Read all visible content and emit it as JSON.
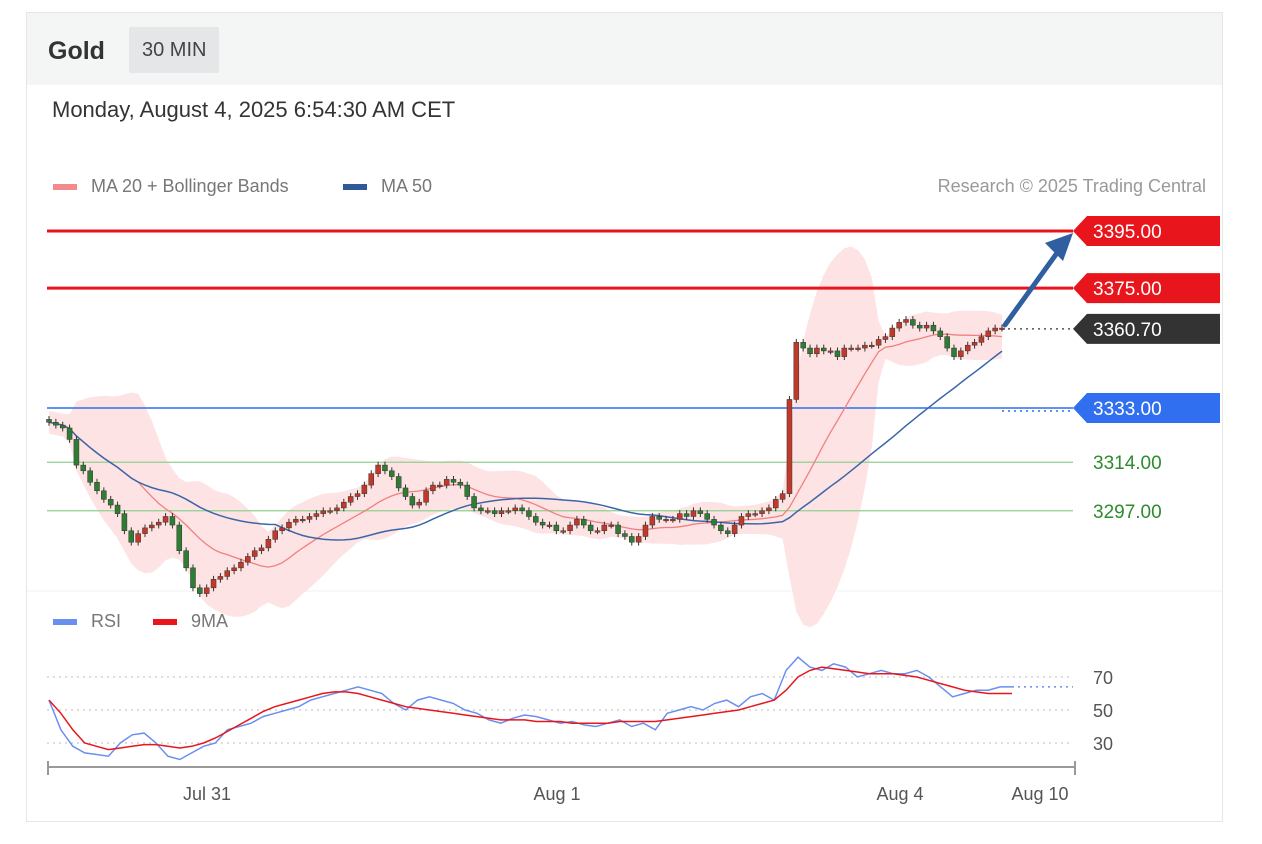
{
  "header": {
    "asset": "Gold",
    "timeframe": "30 MIN"
  },
  "datetime": "Monday, August 4, 2025 6:54:30 AM CET",
  "legend": {
    "ma20_label": "MA 20 + Bollinger Bands",
    "ma50_label": "MA 50"
  },
  "credit": "Research © 2025 Trading Central",
  "rsi_legend": {
    "rsi_label": "RSI",
    "ma_label": "9MA"
  },
  "colors": {
    "red": "#e8161c",
    "blue": "#2f6ff0",
    "green": "#2e8b2e",
    "ma50": "#3a66a8",
    "band": "#fde0e0",
    "current": "#333333"
  },
  "chart_data": [
    {
      "type": "line",
      "title": "",
      "x_ticks": [
        "Jul 31",
        "Aug 1",
        "Aug 4",
        "Aug 10"
      ],
      "ylim": [
        3265,
        3400
      ],
      "levels": [
        {
          "label": "3395.00",
          "value": 3395.0,
          "kind": "resistance",
          "color": "#e8161c"
        },
        {
          "label": "3375.00",
          "value": 3375.0,
          "kind": "resistance",
          "color": "#e8161c"
        },
        {
          "label": "3360.70",
          "value": 3360.7,
          "kind": "current",
          "color": "#333333"
        },
        {
          "label": "3333.00",
          "value": 3333.0,
          "kind": "pivot",
          "color": "#2f6ff0"
        },
        {
          "label": "3314.00",
          "value": 3314.0,
          "kind": "support",
          "color": "#2e8b2e"
        },
        {
          "label": "3297.00",
          "value": 3297.0,
          "kind": "support",
          "color": "#2e8b2e"
        }
      ],
      "candles_close": [
        3328,
        3327,
        3326,
        3322,
        3313,
        3311,
        3307,
        3304,
        3301,
        3299,
        3296,
        3290,
        3286,
        3289,
        3291,
        3292,
        3293,
        3295,
        3292,
        3283,
        3277,
        3270,
        3268,
        3270,
        3273,
        3274,
        3276,
        3277,
        3279,
        3281,
        3283,
        3284,
        3287,
        3290,
        3291,
        3293,
        3294,
        3294,
        3295,
        3296,
        3297,
        3297,
        3298,
        3300,
        3302,
        3303,
        3306,
        3310,
        3313,
        3311,
        3309,
        3305,
        3302,
        3299,
        3300,
        3304,
        3306,
        3306,
        3308,
        3307,
        3306,
        3302,
        3298,
        3297,
        3297,
        3296,
        3297,
        3297,
        3298,
        3297,
        3295,
        3293,
        3292,
        3292,
        3290,
        3290,
        3292,
        3294,
        3292,
        3290,
        3290,
        3292,
        3292,
        3289,
        3288,
        3286,
        3288,
        3292,
        3295,
        3294,
        3294,
        3294,
        3296,
        3295,
        3297,
        3296,
        3294,
        3292,
        3290,
        3289,
        3292,
        3295,
        3296,
        3296,
        3297,
        3298,
        3301,
        3303,
        3336,
        3356,
        3354,
        3352,
        3354,
        3353,
        3353,
        3351,
        3354,
        3354,
        3354,
        3355,
        3355,
        3357,
        3358,
        3361,
        3363,
        3364,
        3362,
        3361,
        3362,
        3360,
        3358,
        3354,
        3351,
        3353,
        3355,
        3356,
        3358,
        3360,
        3361,
        3361
      ],
      "series": [
        {
          "name": "MA 20 + Bollinger Bands",
          "kind": "ma20_band"
        },
        {
          "name": "MA 50",
          "kind": "ma50"
        }
      ]
    },
    {
      "type": "line",
      "title": "",
      "y_ticks": [
        "70",
        "50",
        "30"
      ],
      "ylim": [
        10,
        90
      ],
      "series": [
        {
          "name": "RSI",
          "values": [
            56,
            38,
            28,
            24,
            23,
            22,
            30,
            35,
            36,
            30,
            22,
            20,
            24,
            28,
            30,
            38,
            40,
            42,
            46,
            48,
            50,
            52,
            56,
            58,
            60,
            62,
            64,
            62,
            60,
            54,
            50,
            56,
            58,
            56,
            54,
            50,
            48,
            44,
            42,
            45,
            47,
            46,
            44,
            42,
            43,
            41,
            40,
            42,
            44,
            40,
            42,
            38,
            48,
            50,
            52,
            50,
            54,
            56,
            52,
            58,
            60,
            56,
            74,
            82,
            76,
            74,
            78,
            76,
            70,
            72,
            74,
            72,
            72,
            74,
            70,
            64,
            58,
            60,
            62,
            62,
            64,
            64
          ]
        },
        {
          "name": "9MA",
          "values": [
            56,
            48,
            38,
            30,
            28,
            26,
            27,
            28,
            29,
            29,
            28,
            27,
            28,
            30,
            33,
            37,
            41,
            45,
            49,
            52,
            54,
            56,
            58,
            60,
            61,
            61,
            60,
            58,
            56,
            54,
            52,
            51,
            50,
            49,
            48,
            47,
            46,
            45,
            44,
            44,
            44,
            43,
            43,
            43,
            42,
            42,
            42,
            42,
            43,
            43,
            43,
            43,
            44,
            45,
            46,
            47,
            48,
            49,
            50,
            52,
            54,
            56,
            62,
            70,
            74,
            76,
            75,
            74,
            73,
            72,
            72,
            72,
            71,
            70,
            68,
            66,
            64,
            62,
            61,
            60,
            60,
            60
          ]
        }
      ]
    }
  ]
}
